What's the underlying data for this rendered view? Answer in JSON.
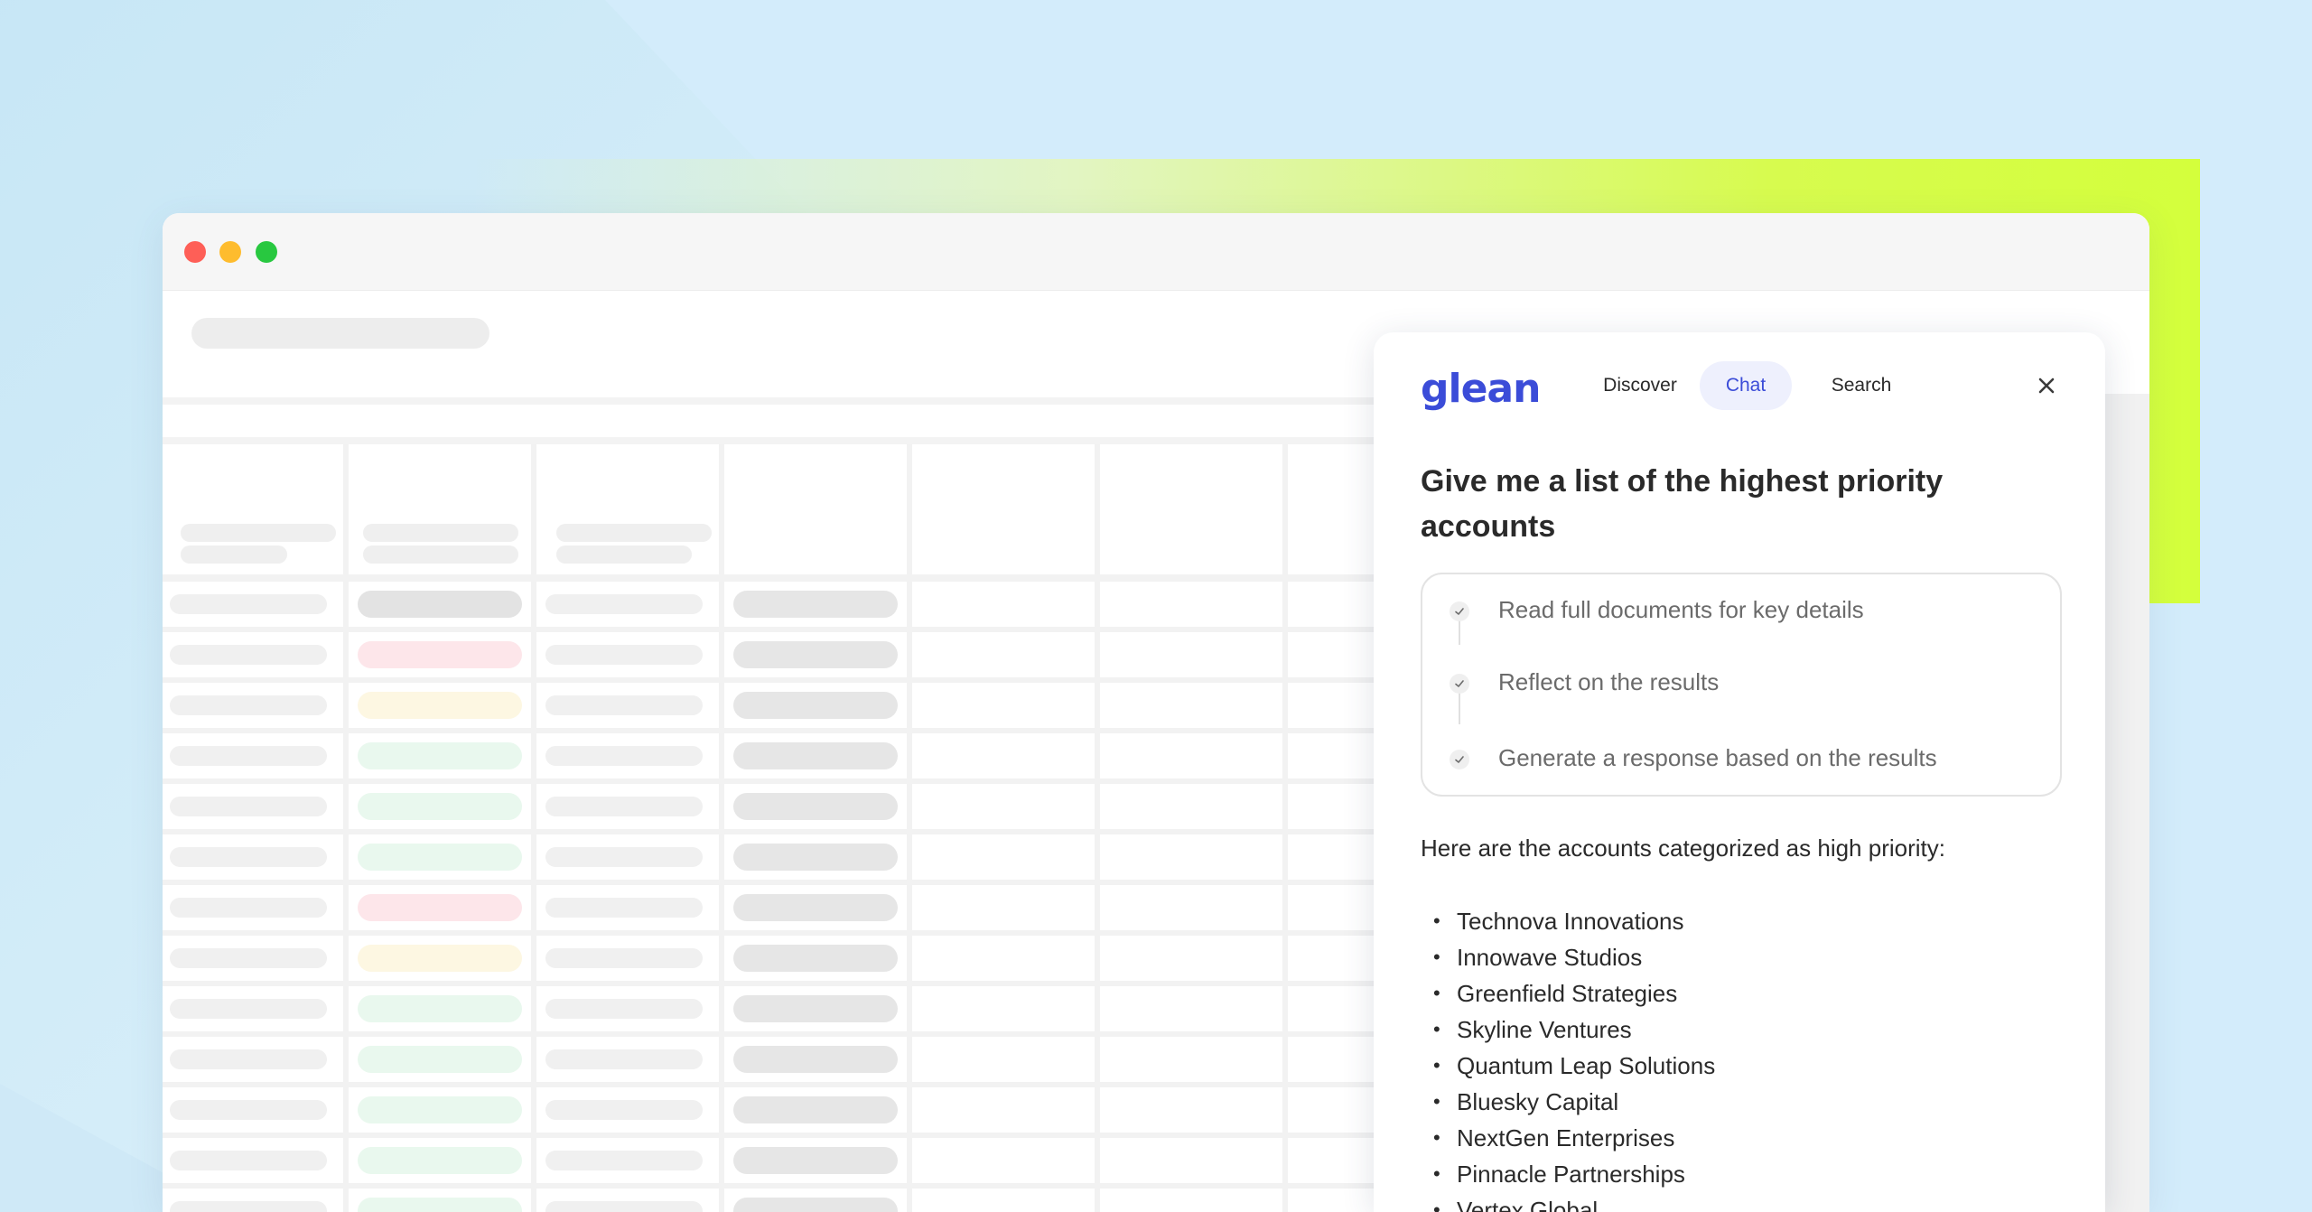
{
  "panel": {
    "logo": "glean",
    "tabs": [
      {
        "label": "Discover",
        "active": false
      },
      {
        "label": "Chat",
        "active": true
      },
      {
        "label": "Search",
        "active": false
      }
    ],
    "close_icon": "close-icon",
    "question": "Give me a list of the highest priority accounts",
    "steps": [
      {
        "label": "Read full documents for key details",
        "icon": "check-icon"
      },
      {
        "label": "Reflect on the results",
        "icon": "check-icon"
      },
      {
        "label": "Generate a response based on the results",
        "icon": "check-icon"
      }
    ],
    "answer_intro": "Here are the accounts categorized as high priority:",
    "bullet": "•",
    "accounts": [
      "Technova Innovations",
      "Innowave Studios",
      "Greenfield Strategies",
      "Skyline Ventures",
      "Quantum Leap Solutions",
      "Bluesky Capital",
      "NextGen Enterprises",
      "Pinnacle Partnerships",
      "Vertex Global"
    ]
  },
  "colors": {
    "accent": "#3b4cd8",
    "chat_tab_bg": "#eef0fd",
    "status_red": "#fde6ea",
    "status_yellow": "#fdf7e2",
    "status_green": "#e9f8ee",
    "background": "#d3ecfb",
    "band": "#d4ff3c"
  },
  "table_status_rows": [
    "neutral",
    "red",
    "yellow",
    "green",
    "green",
    "green",
    "red",
    "yellow",
    "green",
    "green",
    "green",
    "green",
    "green"
  ]
}
